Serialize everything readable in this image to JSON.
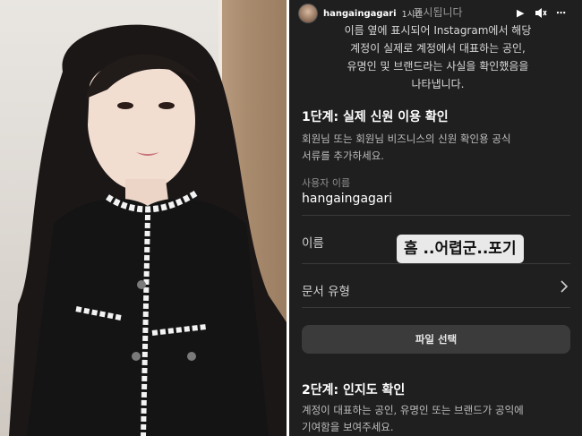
{
  "story": {
    "username": "hangaingagari",
    "time": "1시간",
    "controls": {
      "play": "▶",
      "mute": "🔇",
      "more": "⋯"
    },
    "intro": {
      "line0": "표시됩니다",
      "line1": "이름 옆에 표시되어 Instagram에서 해당",
      "line2": "계정이 실제로 계정에서 대표하는 공인,",
      "line3": "유명인 및 브랜드라는 사실을 확인했음을",
      "line4": "나타냅니다."
    },
    "step1": {
      "title": "1단계: 실제 신원 이용 확인",
      "desc_line1": "회원님 또는 회원님 비즈니스의 신원 확인용 공식",
      "desc_line2": "서류를 추가하세요.",
      "username_label": "사용자 이름",
      "username_value": "hangaingagari",
      "name_label": "이름",
      "doc_type_label": "문서 유형",
      "file_button": "파일 선택"
    },
    "sticker": "흠 ..어렵군..포기",
    "step2": {
      "title": "2단계: 인지도 확인",
      "desc_line1": "계정이 대표하는 공인, 유명인 또는 브랜드가 공익에",
      "desc_line2": "기여함을 보여주세요."
    }
  }
}
